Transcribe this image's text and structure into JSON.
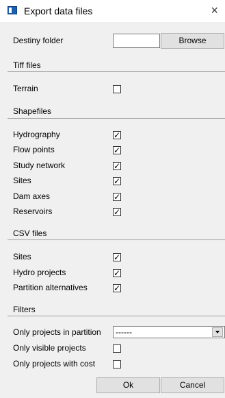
{
  "window": {
    "title": "Export data files",
    "close_glyph": "×"
  },
  "destiny": {
    "label": "Destiny folder",
    "value": "",
    "browse_label": "Browse"
  },
  "sections": {
    "tiff": {
      "title": "Tiff files",
      "items": [
        {
          "label": "Terrain",
          "checked": false
        }
      ]
    },
    "shapefiles": {
      "title": "Shapefiles",
      "items": [
        {
          "label": "Hydrography",
          "checked": true
        },
        {
          "label": "Flow points",
          "checked": true
        },
        {
          "label": "Study network",
          "checked": true
        },
        {
          "label": "Sites",
          "checked": true
        },
        {
          "label": "Dam axes",
          "checked": true
        },
        {
          "label": "Reservoirs",
          "checked": true
        }
      ]
    },
    "csv": {
      "title": "CSV files",
      "items": [
        {
          "label": "Sites",
          "checked": true
        },
        {
          "label": "Hydro projects",
          "checked": true
        },
        {
          "label": "Partition alternatives",
          "checked": true
        }
      ]
    },
    "filters": {
      "title": "Filters",
      "partition_label": "Only projects in partition",
      "partition_value": "------",
      "visible_label": "Only visible projects",
      "visible_checked": false,
      "cost_label": "Only projects with cost",
      "cost_checked": false
    }
  },
  "buttons": {
    "ok": "Ok",
    "cancel": "Cancel"
  },
  "check_mark": "✓"
}
